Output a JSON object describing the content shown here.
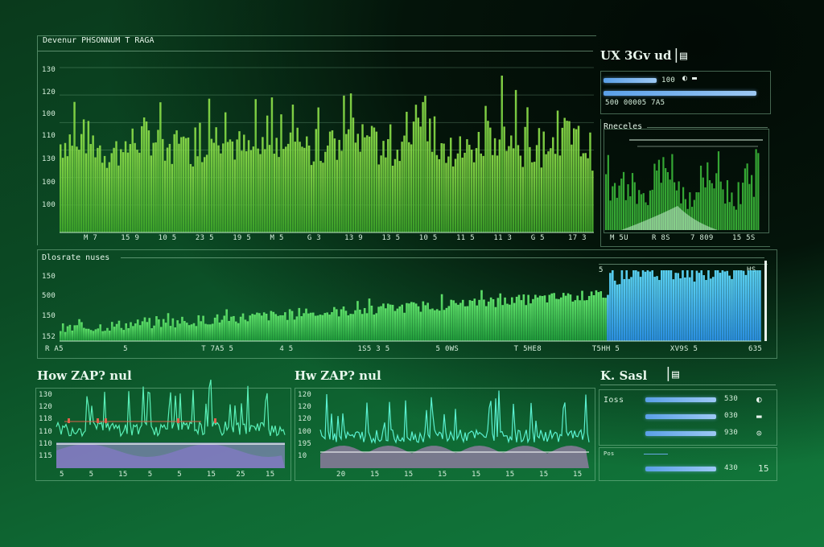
{
  "top_chart": {
    "title": "Devenur PHSONNUM T RAGA",
    "y_ticks": [
      "130",
      "120",
      "100",
      "110",
      "130",
      "100"
    ],
    "x_ticks": [
      "M 7",
      "15 9",
      "10 5",
      "23 5",
      "19 5",
      "M 5",
      "G 3",
      "13 9",
      "13 5",
      "10 5",
      "11 5",
      "11 3",
      "G 5",
      "17 3"
    ]
  },
  "mid_chart": {
    "title": "Dlosrate nuses",
    "y_ticks": [
      "150",
      "500",
      "150",
      "152"
    ],
    "x_ticks": [
      "R A5",
      "5",
      "T 7A5 5",
      "4 5",
      "1S5 3 5",
      "5 0WS",
      "T 5HE8",
      "T5HH 5",
      "XV9S 5",
      "635"
    ],
    "left_label": "5",
    "right_label": "HS"
  },
  "right_top": {
    "title": "UX 3Gv ud",
    "bar1_label": "100",
    "bar2_label": "500 00005  7A5",
    "bar1_level": 0.5,
    "bar2_level": 0.95
  },
  "right_mini": {
    "title": "Rneceles",
    "x_ticks": [
      "M 5U",
      "R 8S",
      "7 809",
      "15 5S"
    ]
  },
  "bottom_left": {
    "title": "How ZAP? nul",
    "y_ticks": [
      "130",
      "120",
      "118",
      "110",
      "110",
      "115"
    ],
    "x_ticks": [
      "5",
      "5",
      "15",
      "5",
      "5",
      "15",
      "25",
      "15"
    ]
  },
  "bottom_mid": {
    "title": "Hw ZAP? nul",
    "y_ticks": [
      "120",
      "120",
      "120",
      "100",
      "195",
      "10"
    ],
    "x_ticks": [
      "20",
      "15",
      "15",
      "15",
      "15",
      "15",
      "15",
      "15"
    ]
  },
  "bottom_right": {
    "title": "K. Sasl",
    "label": "Ioss",
    "rows": [
      {
        "value": "530",
        "level": 0.7
      },
      {
        "value": "030",
        "level": 0.7
      },
      {
        "value": "930",
        "level": 0.7
      }
    ],
    "footer_label": "Pos",
    "footer_value": "430",
    "footer_level": 0.7,
    "footer_number": "15"
  },
  "chart_data": [
    {
      "type": "bar",
      "title": "Devenur PHSONNUM T RAGA",
      "note": "dense green bar series"
    },
    {
      "type": "area",
      "title": "Dlosrate nuses",
      "note": "green then blue bar series"
    },
    {
      "type": "area",
      "title": "Rneceles"
    },
    {
      "type": "line",
      "title": "How ZAP? nul"
    },
    {
      "type": "line",
      "title": "Hw ZAP? nul"
    }
  ]
}
